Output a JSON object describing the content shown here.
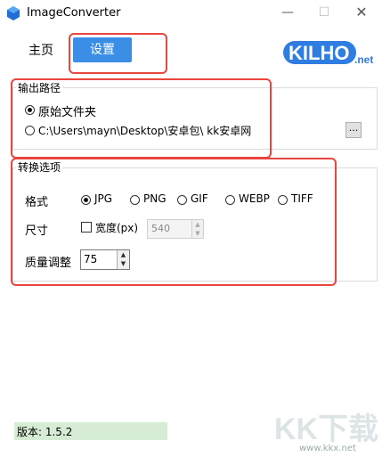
{
  "window": {
    "title": "ImageConverter",
    "min_symbol": "—",
    "max_symbol": "☐",
    "close_symbol": "✕"
  },
  "tabs": [
    {
      "label": "主页",
      "active": false
    },
    {
      "label": "设置",
      "active": true
    }
  ],
  "logo": {
    "text": "KILHO",
    "suffix": ".net",
    "color": "#2f7de1"
  },
  "output": {
    "legend": "输出路径",
    "option_original": "原始文件夹",
    "option_custom": "C:\\Users\\mayn\\Desktop\\安卓包\\ kk安卓网",
    "selected": "original",
    "browse_label": "..."
  },
  "convert": {
    "legend": "转换选项",
    "format_label": "格式",
    "formats": [
      "JPG",
      "PNG",
      "GIF",
      "WEBP",
      "TIFF"
    ],
    "selected_format": "JPG",
    "size_label": "尺寸",
    "width_checkbox_label": "宽度(px)",
    "width_checked": false,
    "width_value": "540",
    "quality_label": "质量调整",
    "quality_value": "75"
  },
  "version": "版本: 1.5.2",
  "watermark": {
    "text": "KK下载",
    "url": "www.kkx.net"
  },
  "colors": {
    "accent": "#3a8ee6",
    "highlight_border": "#e8463e",
    "version_bg": "#d6ecd4"
  }
}
